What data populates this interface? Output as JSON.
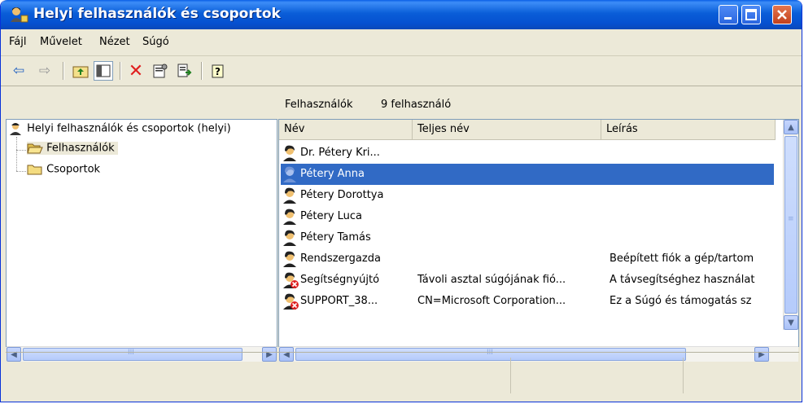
{
  "window": {
    "title": "Helyi felhasználók és csoportok"
  },
  "menu": [
    "Fájl",
    "Művelet",
    "Nézet",
    "Súgó"
  ],
  "tree": {
    "root": "Helyi felhasználók és csoportok (helyi)",
    "children": [
      "Felhasználók",
      "Csoportok"
    ]
  },
  "right_header": {
    "title": "Felhasználók",
    "count": "9 felhasználó"
  },
  "list": {
    "columns": [
      "Név",
      "Teljes név",
      "Leírás"
    ],
    "rows": [
      {
        "name": "Dr. Pétery Kri...",
        "full": "",
        "desc": "",
        "disabled": false
      },
      {
        "name": "Pétery Anna",
        "full": "",
        "desc": "",
        "disabled": false,
        "selected": true
      },
      {
        "name": "Pétery Dorottya",
        "full": "",
        "desc": "",
        "disabled": false
      },
      {
        "name": "Pétery Luca",
        "full": "",
        "desc": "",
        "disabled": false
      },
      {
        "name": "Pétery Tamás",
        "full": "",
        "desc": "",
        "disabled": false
      },
      {
        "name": "Rendszergazda",
        "full": "",
        "desc": "Beépített fiók a gép/tartom",
        "disabled": false
      },
      {
        "name": "Segítségnyújtó",
        "full": "Távoli asztal súgójának fió...",
        "desc": "A távsegítséghez használat",
        "disabled": true
      },
      {
        "name": "SUPPORT_38...",
        "full": "CN=Microsoft Corporation...",
        "desc": "Ez a Súgó és támogatás sz",
        "disabled": true
      }
    ]
  },
  "scroll": {
    "tick": "III"
  },
  "colors": {
    "selection": "#316ac5",
    "titlebar": "#0a5ed8",
    "close": "#c2401d"
  }
}
